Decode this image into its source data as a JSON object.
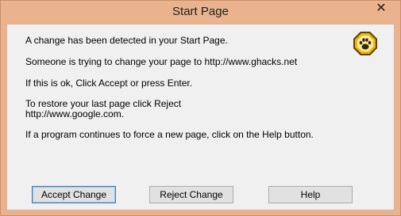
{
  "window": {
    "title": "Start Page",
    "close_glyph": "✕"
  },
  "messages": {
    "line1": "A change has been detected in your Start Page.",
    "line2": "Someone is trying to change your page to http://www.ghacks.net",
    "line3": "If this is ok, Click Accept or press Enter.",
    "line4": "To restore your last page click Reject",
    "line5": "http://www.google.com.",
    "line6": "If a program continues to force a new page, click on the Help button."
  },
  "buttons": {
    "accept_label": "Accept Change",
    "reject_label": "Reject Change",
    "help_label": "Help"
  },
  "icons": {
    "app_logo": "paw-print-octagon-icon",
    "close": "close-icon"
  },
  "colors": {
    "title_bar": "#eab38e",
    "client_bg": "#f0f0f0",
    "logo_fill": "#f4b400",
    "logo_outline": "#5a4300"
  }
}
